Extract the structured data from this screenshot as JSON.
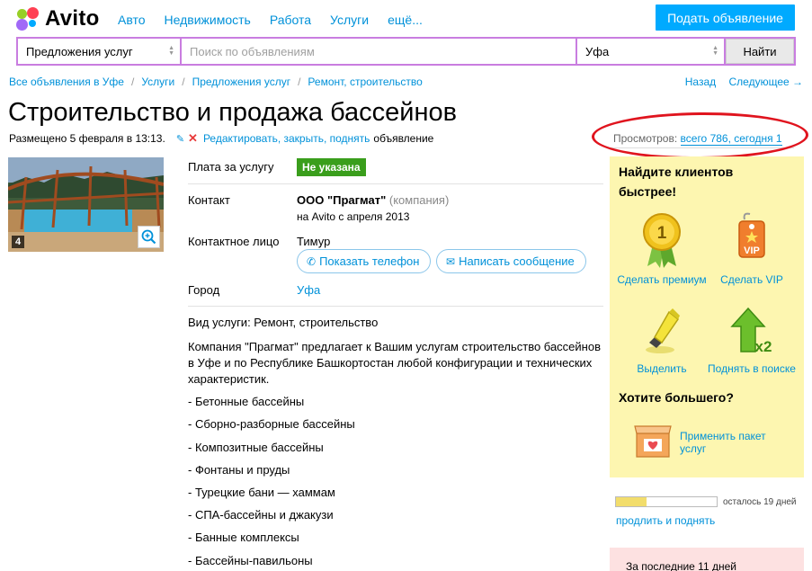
{
  "header": {
    "logo_text": "Avito",
    "nav": [
      "Авто",
      "Недвижимость",
      "Работа",
      "Услуги",
      "ещё..."
    ],
    "post_button": "Подать объявление",
    "brand_colors": [
      "#a169f7",
      "#ff4053",
      "#97cf26",
      "#00aaff"
    ]
  },
  "search": {
    "category": "Предложения услуг",
    "placeholder": "Поиск по объявлениям",
    "city": "Уфа",
    "find_button": "Найти"
  },
  "breadcrumbs": [
    "Все объявления в Уфе",
    "Услуги",
    "Предложения услуг",
    "Ремонт, строительство"
  ],
  "pager": {
    "back": "Назад",
    "next": "Следующее →"
  },
  "listing": {
    "title": "Строительство и продажа бассейнов",
    "posted": "Размещено 5 февраля в 13:13.",
    "edit_link": "Редактировать, закрыть, поднять",
    "edit_tail": "объявление",
    "views_label": "Просмотров:",
    "views_value": "всего 786, сегодня 1",
    "photo_count": "4"
  },
  "details": {
    "price_label": "Плата за услугу",
    "price_value": "Не указана",
    "contact_label": "Контакт",
    "company": "ООО \"Прагмат\"",
    "company_type": "(компания)",
    "since": "на Avito с апреля 2013",
    "person_label": "Контактное лицо",
    "person": "Тимур",
    "show_phone": "Показать телефон",
    "write_message": "Написать сообщение",
    "city_label": "Город",
    "city": "Уфа"
  },
  "description": {
    "service_type": "Вид услуги: Ремонт, строительство",
    "intro": "Компания \"Прагмат\" предлагает к Вашим услугам строительство бассейнов в Уфе и по Республике Башкортостан любой конфигурации и технических характеристик.",
    "items": [
      "- Бетонные бассейны",
      "- Сборно-разборные бассейны",
      "- Композитные бассейны",
      "- Фонтаны и пруды",
      "- Турецкие бани — хаммам",
      "- СПА-бассейны и джакузи",
      "- Банные комплексы",
      "- Бассейны-павильоны"
    ]
  },
  "promo": {
    "heading1": "Найдите клиентов быстрее!",
    "premium": "Сделать премиум",
    "vip": "Сделать VIP",
    "vip_badge": "VIP",
    "premium_badge": "1",
    "highlight": "Выделить",
    "raise": "Поднять в поиске",
    "raise_badge": "x2",
    "heading2": "Хотите большего?",
    "package": "Применить пакет услуг"
  },
  "status": {
    "days_left": "осталось 19 дней",
    "progress_fraction": 0.3,
    "extend": "продлить и поднять",
    "stats": "За последние 11 дней"
  }
}
